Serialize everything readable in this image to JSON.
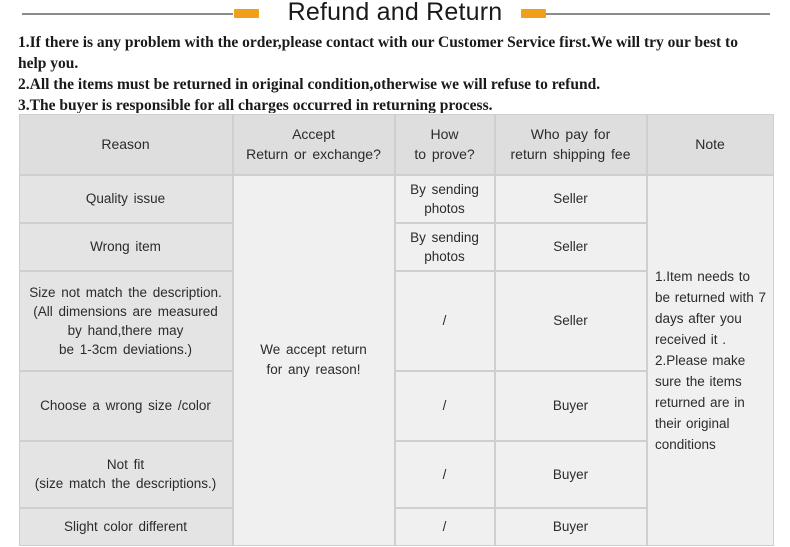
{
  "header": {
    "title": "Refund and Return",
    "rule_color": "#8c8c8c",
    "dash_color": "#f0a018"
  },
  "intro": {
    "line1": "1.If there is any problem with the order,please contact with our Customer Service first.We will try our best to help you.",
    "line2": "2.All the items must be returned in original condition,otherwise we will refuse to refund.",
    "line3": "3.The buyer is responsible for all charges occurred in returning process."
  },
  "table": {
    "headers": {
      "reason": "Reason",
      "accept": "Accept\nReturn  or  exchange?",
      "prove": "How\nto  prove?",
      "who_pay": "Who  pay  for\nreturn  shipping  fee",
      "note": "Note"
    },
    "merged": {
      "accept_all": "We  accept  return\nfor  any  reason!",
      "note_all": "1.Item  needs  to  be  returned  with  7  days  after  you  received  it  .\n2.Please  make  sure  the  items  returned  are  in  their  original  conditions"
    },
    "rows": [
      {
        "reason": "Quality  issue",
        "prove": "By  sending\nphotos",
        "who_pay": "Seller"
      },
      {
        "reason": "Wrong  item",
        "prove": "By  sending\nphotos",
        "who_pay": "Seller"
      },
      {
        "reason": "Size  not  match  the  description.\n(All  dimensions  are  measured\nby  hand,there  may\nbe  1-3cm  deviations.)",
        "prove": "/",
        "who_pay": "Seller"
      },
      {
        "reason": "Choose  a  wrong  size  /color",
        "prove": "/",
        "who_pay": "Buyer"
      },
      {
        "reason": "Not  fit\n(size  match  the  descriptions.)",
        "prove": "/",
        "who_pay": "Buyer"
      },
      {
        "reason": "Slight  color  different",
        "prove": "/",
        "who_pay": "Buyer"
      }
    ]
  },
  "colors": {
    "header_row_bg": "#dedede",
    "first_col_bg": "#e4e4e4",
    "cell_bg": "#f0f0f0",
    "grid": "#cfcfcf",
    "accent": "#f0a018"
  }
}
